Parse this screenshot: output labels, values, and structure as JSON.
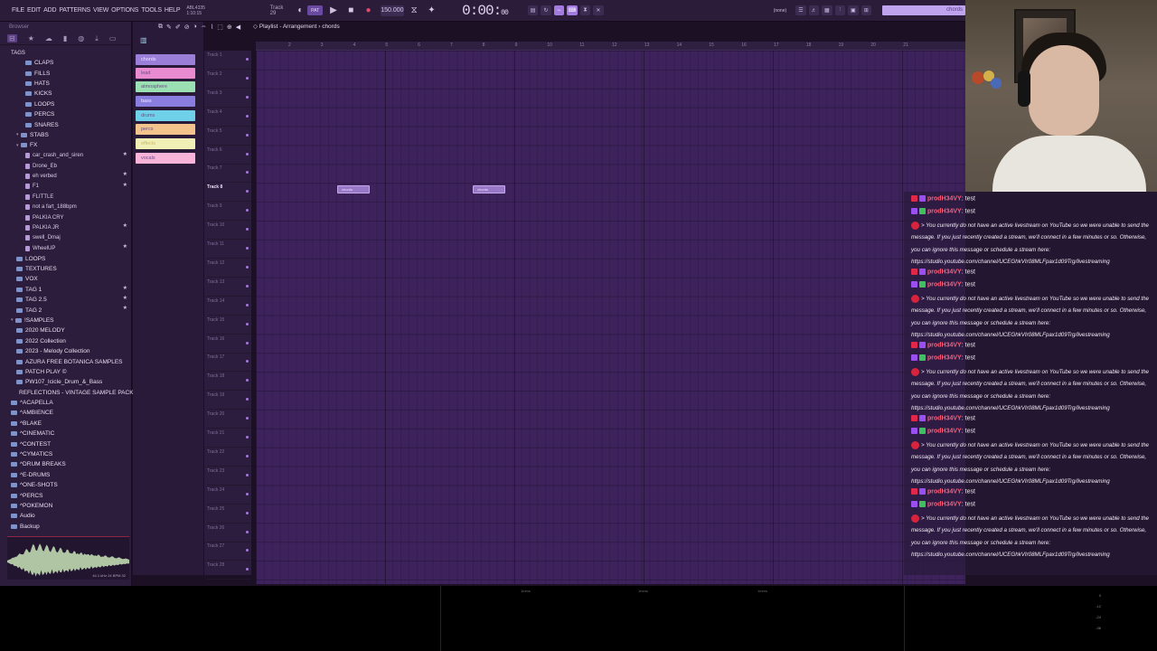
{
  "menu": [
    "FILE",
    "EDIT",
    "ADD",
    "PATTERNS",
    "VIEW",
    "OPTIONS",
    "TOOLS",
    "HELP"
  ],
  "project": {
    "line1": "ABL4335",
    "line2": "1:10:15"
  },
  "track_label": "Track 29",
  "transport": {
    "pattern": "PAT",
    "bpm": "150.000",
    "time": "0:00",
    "time_small": "00"
  },
  "mixer_none": "(none)",
  "search_text": "chords",
  "browser": {
    "title": "Browser",
    "tags_label": "TAGS",
    "items": [
      {
        "label": "CLAPS",
        "type": "folder"
      },
      {
        "label": "FILLS",
        "type": "folder"
      },
      {
        "label": "HATS",
        "type": "folder"
      },
      {
        "label": "KICKS",
        "type": "folder"
      },
      {
        "label": "LOOPS",
        "type": "folder"
      },
      {
        "label": "PERCS",
        "type": "folder"
      },
      {
        "label": "SNARES",
        "type": "folder"
      },
      {
        "label": "STABS",
        "type": "folder-open"
      },
      {
        "label": "FX",
        "type": "folder-open"
      },
      {
        "label": "car_crash_and_siren",
        "type": "file",
        "star": true
      },
      {
        "label": "Drone_Eb",
        "type": "file"
      },
      {
        "label": "eh verbed",
        "type": "file",
        "star": true
      },
      {
        "label": "F1",
        "type": "file",
        "star": true
      },
      {
        "label": "FLITTLE",
        "type": "file"
      },
      {
        "label": "not a fart_188bpm",
        "type": "file"
      },
      {
        "label": "PALKIA CRY",
        "type": "file"
      },
      {
        "label": "PALKIA JR",
        "type": "file",
        "star": true
      },
      {
        "label": "swell_Dmaj",
        "type": "file"
      },
      {
        "label": "WheelUP",
        "type": "file",
        "star": true
      },
      {
        "label": "LOOPS",
        "type": "folder"
      },
      {
        "label": "TEXTURES",
        "type": "folder"
      },
      {
        "label": "VOX",
        "type": "folder"
      },
      {
        "label": "TAG 1",
        "type": "folder",
        "star": true
      },
      {
        "label": "TAG 2.5",
        "type": "folder",
        "star": true
      },
      {
        "label": "TAG 2",
        "type": "folder",
        "star": true
      },
      {
        "label": "!SAMPLES",
        "type": "folder-open"
      },
      {
        "label": "2020 MELODY",
        "type": "folder"
      },
      {
        "label": "2022 Collection",
        "type": "folder"
      },
      {
        "label": "2023 - Melody Collection",
        "type": "folder"
      },
      {
        "label": "AZURA FREE BOTANICA SAMPLES",
        "type": "folder"
      },
      {
        "label": "PATCH PLAY ©",
        "type": "folder"
      },
      {
        "label": "PW107_Icicle_Drum_&_Bass",
        "type": "folder"
      },
      {
        "label": "REFLECTIONS - VINTAGE SAMPLE PACK",
        "type": "folder"
      },
      {
        "label": "^ACAPELLA",
        "type": "folder"
      },
      {
        "label": "^AMBIENCE",
        "type": "folder"
      },
      {
        "label": "^BLAKE",
        "type": "folder"
      },
      {
        "label": "^CINEMATIC",
        "type": "folder"
      },
      {
        "label": "^CONTEST",
        "type": "folder"
      },
      {
        "label": "^CYMATICS",
        "type": "folder"
      },
      {
        "label": "^DRUM BREAKS",
        "type": "folder"
      },
      {
        "label": "^E-DRUMS",
        "type": "folder"
      },
      {
        "label": "^ONE-SHOTS",
        "type": "folder"
      },
      {
        "label": "^PERCS",
        "type": "folder"
      },
      {
        "label": "^POKEMON",
        "type": "folder"
      },
      {
        "label": "Audio",
        "type": "folder"
      },
      {
        "label": "Backup",
        "type": "folder"
      }
    ],
    "wave_info": "44.1 kHz 24 BPM 32"
  },
  "picker": {
    "clips": [
      {
        "label": "chords",
        "color": "#9a7ed8"
      },
      {
        "label": "lead",
        "color": "#e98bd0"
      },
      {
        "label": "atmosphere",
        "color": "#9ae0b2"
      },
      {
        "label": "bass",
        "color": "#8a7de0"
      },
      {
        "label": "drums",
        "color": "#6fd0ea"
      },
      {
        "label": "percs",
        "color": "#f2c38b"
      },
      {
        "label": "effects",
        "color": "#f0efb5"
      },
      {
        "label": "vocals",
        "color": "#f7b4d8"
      }
    ]
  },
  "playlist": {
    "title": "Playlist - Arrangement",
    "pattern": "chords",
    "ruler": [
      "2",
      "3",
      "4",
      "5",
      "6",
      "7",
      "8",
      "9",
      "10",
      "11",
      "12",
      "13",
      "14",
      "15",
      "16",
      "17",
      "18",
      "19",
      "20",
      "21"
    ],
    "tracks": [
      "Track 1",
      "Track 2",
      "Track 3",
      "Track 4",
      "Track 5",
      "Track 6",
      "Track 7",
      "Track 8",
      "Track 9",
      "Track 10",
      "Track 11",
      "Track 12",
      "Track 13",
      "Track 14",
      "Track 15",
      "Track 16",
      "Track 17",
      "Track 18",
      "Track 19",
      "Track 20",
      "Track 21",
      "Track 22",
      "Track 23",
      "Track 24",
      "Track 25",
      "Track 26",
      "Track 27",
      "Track 28"
    ],
    "highlight_track": "Track 8",
    "clips": [
      {
        "label": "chords"
      },
      {
        "label": "chords"
      }
    ]
  },
  "chat": {
    "entries": [
      {
        "user": "prodH34VY",
        "text": "test",
        "badge": "yt"
      },
      {
        "user": "prodH34VY",
        "text": "test",
        "badge": "tw"
      },
      {
        "error": "> You currently do not have an active livestream on YouTube so we were unable to send the message. If you just recently created a stream, we'll connect in a few minutes or so. Otherwise, you can ignore this message or schedule a stream here: https://studio.youtube.com/channel/UCEGhkVIr08MLFpax1d09Trg/livestreaming"
      },
      {
        "user": "prodH34VY",
        "text": "test",
        "badge": "yt"
      },
      {
        "user": "prodH34VY",
        "text": "test",
        "badge": "tw"
      },
      {
        "error": "> You currently do not have an active livestream on YouTube so we were unable to send the message. If you just recently created a stream, we'll connect in a few minutes or so. Otherwise, you can ignore this message or schedule a stream here: https://studio.youtube.com/channel/UCEGhkVIr08MLFpax1d09Trg/livestreaming"
      },
      {
        "user": "prodH34VY",
        "text": "test",
        "badge": "yt"
      },
      {
        "user": "prodH34VY",
        "text": "test",
        "badge": "tw"
      },
      {
        "error": "> You currently do not have an active livestream on YouTube so we were unable to send the message. If you just recently created a stream, we'll connect in a few minutes or so. Otherwise, you can ignore this message or schedule a stream here: https://studio.youtube.com/channel/UCEGhkVIr08MLFpax1d09Trg/livestreaming"
      },
      {
        "user": "prodH34VY",
        "text": "test",
        "badge": "yt"
      },
      {
        "user": "prodH34VY",
        "text": "test",
        "badge": "tw"
      },
      {
        "error": "> You currently do not have an active livestream on YouTube so we were unable to send the message. If you just recently created a stream, we'll connect in a few minutes or so. Otherwise, you can ignore this message or schedule a stream here: https://studio.youtube.com/channel/UCEGhkVIr08MLFpax1d09Trg/livestreaming"
      },
      {
        "user": "prodH34VY",
        "text": "test",
        "badge": "yt"
      },
      {
        "user": "prodH34VY",
        "text": "test",
        "badge": "tw"
      },
      {
        "error": "> You currently do not have an active livestream on YouTube so we were unable to send the message. If you just recently created a stream, we'll connect in a few minutes or so. Otherwise, you can ignore this message or schedule a stream here: https://studio.youtube.com/channel/UCEGhkVIr08MLFpax1d09Trg/livestreaming"
      }
    ]
  },
  "bottom": {
    "markers": [
      "1mms",
      "1mms",
      "1mms"
    ],
    "meter": [
      "0",
      "-12",
      "-24",
      "-36"
    ]
  },
  "colors": {
    "accent": "#a27ae0",
    "chat_user": "#ff5e79",
    "grid": "#3d225c"
  }
}
